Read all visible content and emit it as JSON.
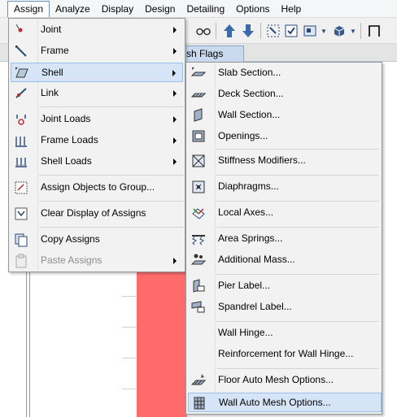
{
  "menubar": {
    "items": [
      "Assign",
      "Analyze",
      "Display",
      "Design",
      "Detailing",
      "Options",
      "Help"
    ]
  },
  "tab": {
    "label": "sh Flags"
  },
  "assign_menu": {
    "items": [
      {
        "label": "Joint",
        "icon": "joint-icon",
        "submenu": true
      },
      {
        "label": "Frame",
        "icon": "frame-icon",
        "submenu": true
      },
      {
        "label": "Shell",
        "icon": "shell-icon",
        "submenu": true,
        "highlighted": true
      },
      {
        "label": "Link",
        "icon": "link-icon",
        "submenu": true
      },
      {
        "label": "Joint Loads",
        "icon": "joint-loads-icon",
        "submenu": true
      },
      {
        "label": "Frame Loads",
        "icon": "frame-loads-icon",
        "submenu": true
      },
      {
        "label": "Shell Loads",
        "icon": "shell-loads-icon",
        "submenu": true
      },
      {
        "label": "Assign Objects to Group...",
        "icon": "group-icon",
        "submenu": false
      },
      {
        "label": "Clear Display of Assigns",
        "icon": "clear-display-icon",
        "submenu": false
      },
      {
        "label": "Copy Assigns",
        "icon": "copy-icon",
        "submenu": false
      },
      {
        "label": "Paste Assigns",
        "icon": "paste-icon",
        "submenu": true,
        "disabled": true
      }
    ]
  },
  "shell_menu": {
    "items": [
      {
        "label": "Slab Section...",
        "icon": "slab-section-icon"
      },
      {
        "label": "Deck Section...",
        "icon": "deck-section-icon"
      },
      {
        "label": "Wall Section...",
        "icon": "wall-section-icon"
      },
      {
        "label": "Openings...",
        "icon": "openings-icon"
      },
      {
        "label": "Stiffness Modifiers...",
        "icon": "stiffness-modifiers-icon"
      },
      {
        "label": "Diaphragms...",
        "icon": "diaphragms-icon"
      },
      {
        "label": "Local Axes...",
        "icon": "local-axes-icon"
      },
      {
        "label": "Area Springs...",
        "icon": "area-springs-icon"
      },
      {
        "label": "Additional Mass...",
        "icon": "additional-mass-icon"
      },
      {
        "label": "Pier Label...",
        "icon": "pier-label-icon"
      },
      {
        "label": "Spandrel Label...",
        "icon": "spandrel-label-icon"
      },
      {
        "label": "Wall Hinge...",
        "icon": ""
      },
      {
        "label": "Reinforcement for Wall Hinge...",
        "icon": ""
      },
      {
        "label": "Floor Auto Mesh Options...",
        "icon": "floor-mesh-icon"
      },
      {
        "label": "Wall Auto Mesh Options...",
        "icon": "wall-mesh-icon",
        "highlighted": true
      }
    ]
  }
}
